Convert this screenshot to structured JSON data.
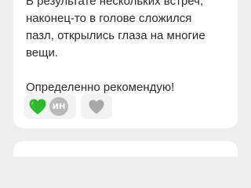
{
  "review": {
    "lines": [
      "В результате нескольких встреч,",
      "наконец-то в голове сложился",
      "пазл, открылись глаза на многие",
      "вещи."
    ],
    "recommendation": "Определенно рекомендую!"
  },
  "reactions": {
    "heart_color": "#2fb82f",
    "reactor_avatar_initials": "ИН",
    "inactive_heart_color": "#a8a8a8"
  }
}
